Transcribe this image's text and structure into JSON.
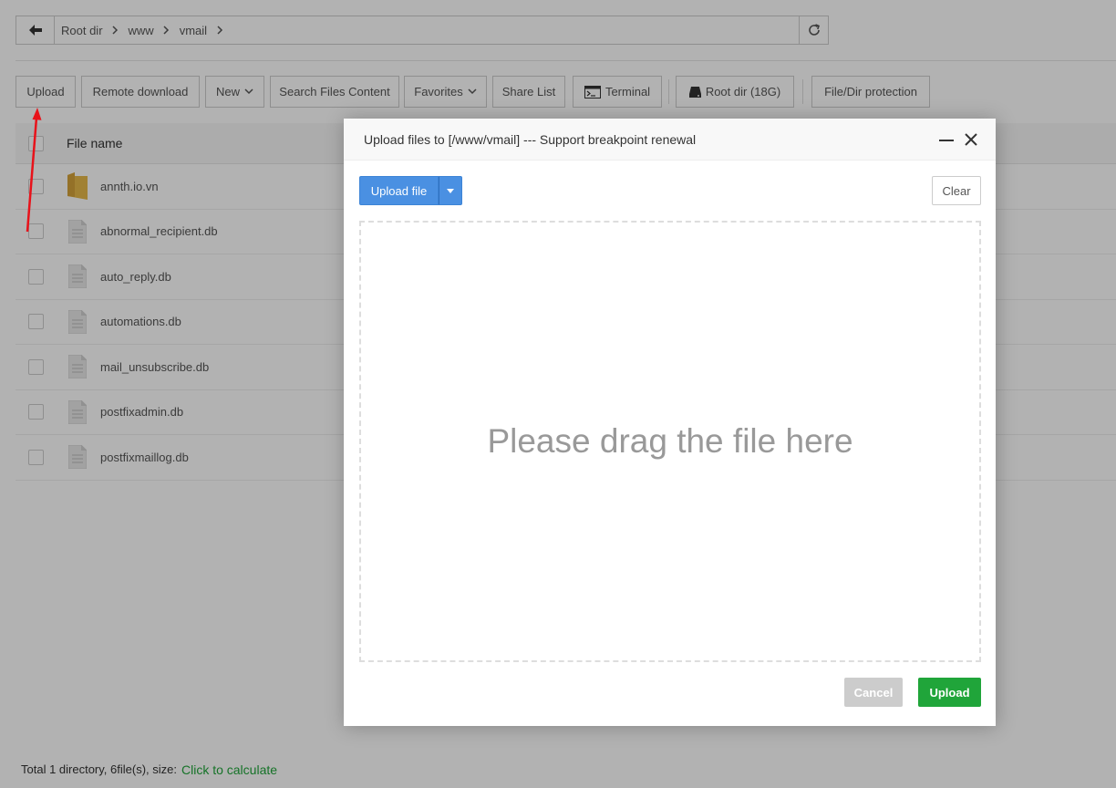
{
  "breadcrumb": [
    "Root dir",
    "www",
    "vmail"
  ],
  "toolbar": {
    "upload": "Upload",
    "remote_download": "Remote download",
    "new": "New",
    "search_files_content": "Search Files Content",
    "favorites": "Favorites",
    "share_list": "Share List",
    "terminal": "Terminal",
    "root_dir": "Root dir (18G)",
    "file_dir_protection": "File/Dir protection"
  },
  "table": {
    "header_name": "File name",
    "rows": [
      {
        "name": "annth.io.vn",
        "type": "folder"
      },
      {
        "name": "abnormal_recipient.db",
        "type": "file"
      },
      {
        "name": "auto_reply.db",
        "type": "file"
      },
      {
        "name": "automations.db",
        "type": "file"
      },
      {
        "name": "mail_unsubscribe.db",
        "type": "file"
      },
      {
        "name": "postfixadmin.db",
        "type": "file"
      },
      {
        "name": "postfixmaillog.db",
        "type": "file"
      }
    ]
  },
  "footer": {
    "summary": "Total 1 directory, 6file(s), size:",
    "calculate_link": "Click to calculate"
  },
  "modal": {
    "title": "Upload files to [/www/vmail] --- Support breakpoint renewal",
    "upload_file_label": "Upload file",
    "clear_label": "Clear",
    "drop_text": "Please drag the file here",
    "cancel_label": "Cancel",
    "upload_label": "Upload"
  },
  "colors": {
    "accent_green": "#20a53a",
    "primary_blue": "#4a90e2",
    "annotation_red": "#e8121a"
  }
}
